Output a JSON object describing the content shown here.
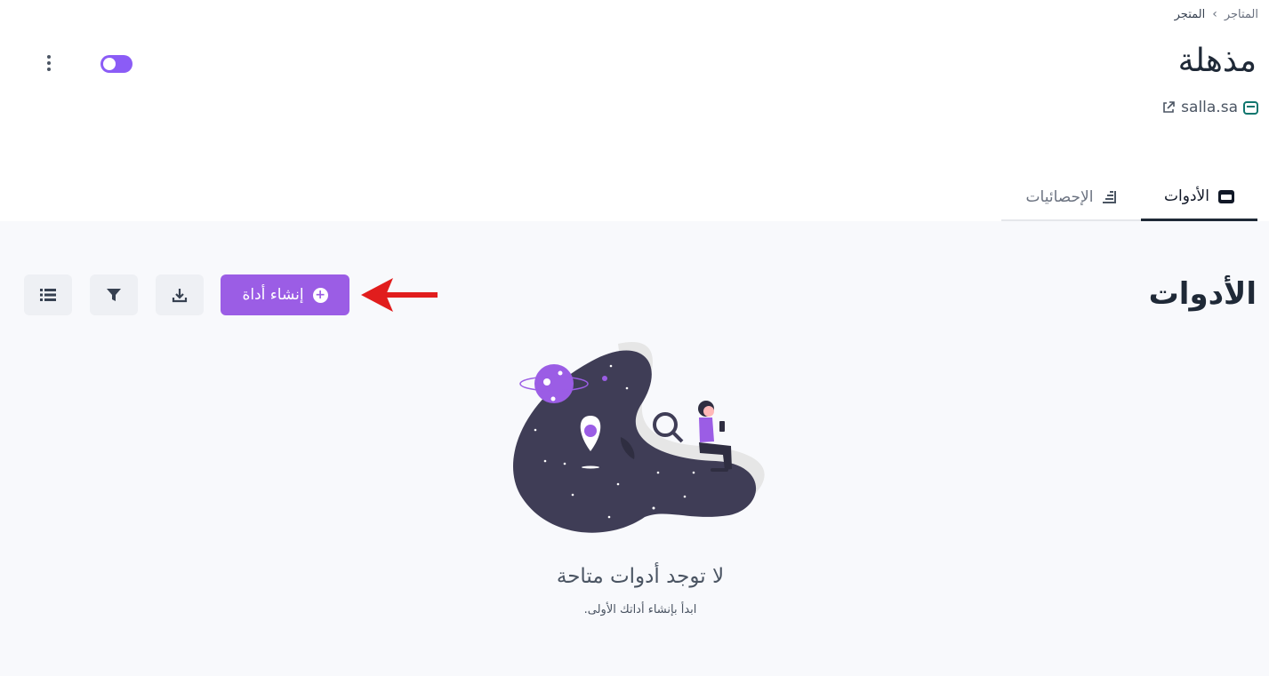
{
  "breadcrumb": {
    "parent": "المتاجر",
    "current": "المتجر"
  },
  "store": {
    "title": "مذهلة",
    "domain": "salla.sa"
  },
  "tabs": [
    {
      "label": "الأدوات",
      "active": true,
      "icon": "card-icon"
    },
    {
      "label": "الإحصائيات",
      "active": false,
      "icon": "chart-icon"
    }
  ],
  "section": {
    "title": "الأدوات",
    "create_label": "إنشاء أداة"
  },
  "toggle": {
    "on": true
  },
  "empty": {
    "title": "لا توجد أدوات متاحة",
    "subtitle": "ابدأ بإنشاء أداتك الأولى."
  },
  "colors": {
    "accent": "#9b5de5",
    "arrow": "#e11d1d",
    "dark": "#3f3d56"
  }
}
